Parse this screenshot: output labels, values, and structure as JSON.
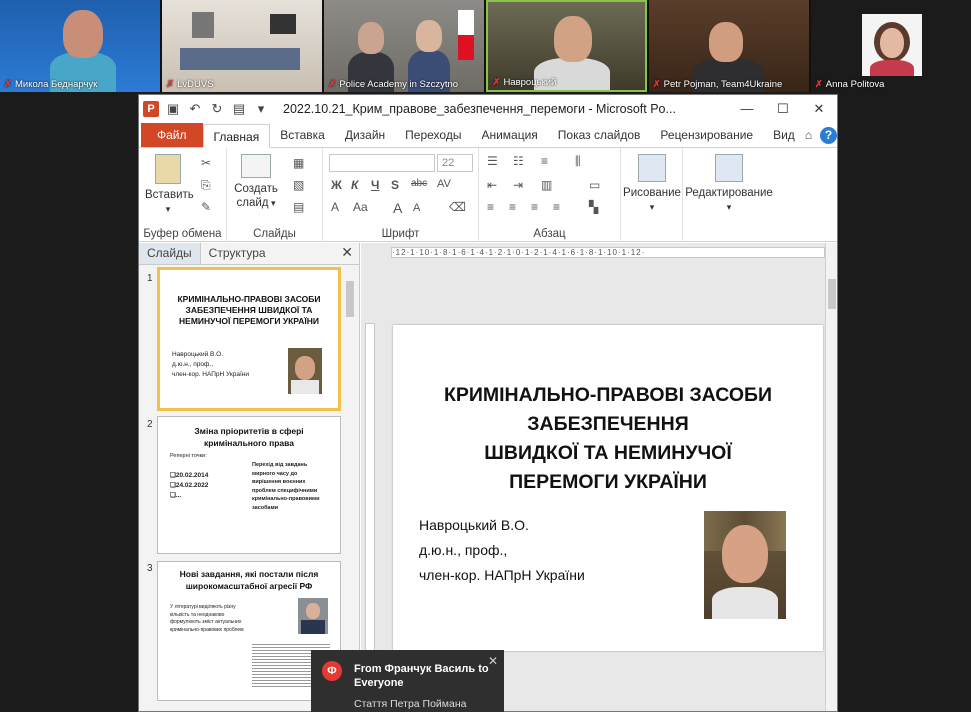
{
  "participants": [
    {
      "name": "Микола Беднарчук"
    },
    {
      "name": "LvDUVS"
    },
    {
      "name": "Police Academy in Szczytno"
    },
    {
      "name": "Навроцький"
    },
    {
      "name": "Petr Pojman, Team4Ukraine"
    },
    {
      "name": "Anna Politova"
    }
  ],
  "window": {
    "title": "2022.10.21_Крим_правове_забезпечення_перемоги - Microsoft Po...",
    "minimize": "—",
    "maximize": "☐",
    "close": "✕"
  },
  "tabs": [
    "Файл",
    "Главная",
    "Вставка",
    "Дизайн",
    "Переходы",
    "Анимация",
    "Показ слайдов",
    "Рецензирование",
    "Вид"
  ],
  "ribbon": {
    "paste": "Вставить",
    "new_slide": "Создать слайд",
    "drawing": "Рисование",
    "editing": "Редактирование",
    "font_size": "22",
    "groups": [
      "Буфер обмена",
      "Слайды",
      "Шрифт",
      "Абзац"
    ]
  },
  "pane": {
    "tab_slides": "Слайды",
    "tab_outline": "Структура",
    "close": "✕"
  },
  "slides": [
    {
      "num": "1",
      "title": "КРИМІНАЛЬНО-ПРАВОВІ ЗАСОБИ ЗАБЕЗПЕЧЕННЯ ШВИДКОЇ ТА НЕМИНУЧОЇ ПЕРЕМОГИ УКРАЇНИ",
      "author": [
        "Навроцький В.О.",
        "д.ю.н., проф.,",
        "член-кор. НАПрН України"
      ]
    },
    {
      "num": "2",
      "title": "Зміна пріоритетів в сфері кримінального права",
      "points_label": "Реперні точки:",
      "points": [
        "20.02.2014",
        "24.02.2022",
        "..."
      ],
      "right": "Перехід від завдань мирного часу до вирішення воєнних проблем специфічними кримінально-правовими засобами"
    },
    {
      "num": "3",
      "title": "Нові завдання, які постали після широкомасштабної агресії РФ",
      "left": "У літературі виділяють різну кількість та неоднаково формулюють зміст актуальних кримінально-правових проблем"
    }
  ],
  "main_slide": {
    "title_lines": [
      "КРИМІНАЛЬНО-ПРАВОВІ ЗАСОБИ",
      "ЗАБЕЗПЕЧЕННЯ",
      "ШВИДКОЇ ТА НЕМИНУЧОЇ",
      "ПЕРЕМОГИ УКРАЇНИ"
    ],
    "author": [
      "Навроцький В.О.",
      "д.ю.н., проф.,",
      "член-кор. НАПрН України"
    ]
  },
  "chat": {
    "avatar": "Ф",
    "from": "From Франчук Василь to Everyone",
    "message": "Стаття Петра Поймана",
    "close": "✕"
  }
}
